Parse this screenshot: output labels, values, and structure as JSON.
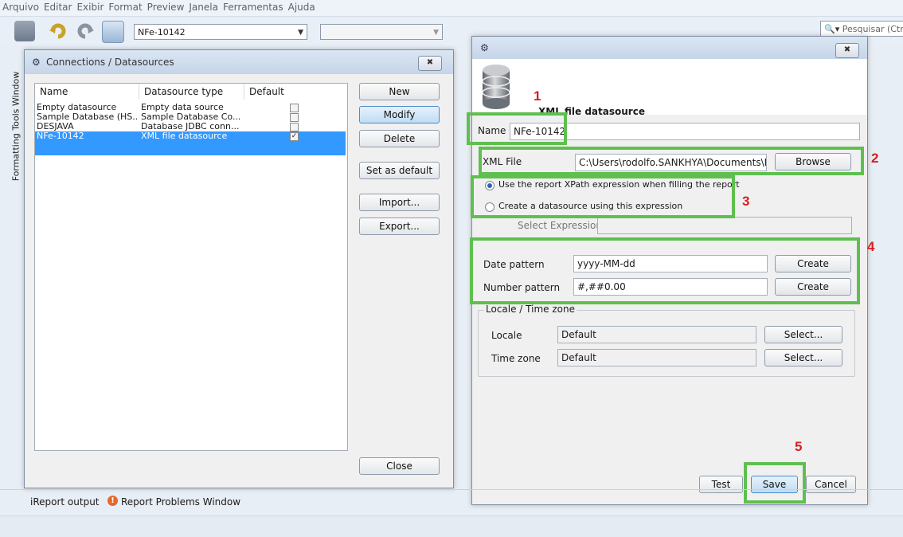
{
  "menu": [
    "Arquivo",
    "Editar",
    "Exibir",
    "Format",
    "Preview",
    "Janela",
    "Ferramentas",
    "Ajuda"
  ],
  "toolbar": {
    "datasource_combo": "NFe-10142",
    "search_placeholder": "Pesquisar (Ctr"
  },
  "side_tab": "Formatting Tools Window",
  "connections": {
    "title": "Connections / Datasources",
    "close_x": "✖",
    "columns": [
      "Name",
      "Datasource type",
      "Default"
    ],
    "rows": [
      {
        "name": "Empty datasource",
        "type": "Empty data source",
        "default": ""
      },
      {
        "name": "Sample Database (HS...",
        "type": "Sample Database Co...",
        "default": ""
      },
      {
        "name": "DESJAVA",
        "type": "Database JDBC conn...",
        "default": ""
      },
      {
        "name": "NFe-10142",
        "type": "XML file datasource",
        "default": "✓"
      }
    ],
    "buttons": {
      "new": "New",
      "modify": "Modify",
      "delete": "Delete",
      "set_default": "Set as default",
      "import": "Import...",
      "export": "Export...",
      "close": "Close"
    }
  },
  "xml_dialog": {
    "close_x": "✖",
    "heading": "XML file datasource",
    "name_label": "Name",
    "name_value": "NFe-10142",
    "xml_file_label": "XML File",
    "xml_file_value": "C:\\Users\\rodolfo.SANKHYA\\Documents\\NFe\\",
    "browse": "Browse",
    "radio_report": "Use the report XPath expression when filling the report",
    "radio_create": "Create a datasource using this expression",
    "select_expression": "Select Expression",
    "date_pattern_label": "Date pattern",
    "date_pattern_value": "yyyy-MM-dd",
    "number_pattern_label": "Number pattern",
    "number_pattern_value": "#,##0.00",
    "create": "Create",
    "locale_group": "Locale / Time zone",
    "locale_label": "Locale",
    "locale_value": "Default",
    "timezone_label": "Time zone",
    "timezone_value": "Default",
    "select": "Select...",
    "test": "Test",
    "save": "Save",
    "cancel": "Cancel"
  },
  "annotations": [
    "1",
    "2",
    "3",
    "4",
    "5"
  ],
  "status_bar": {
    "ireport_output": "iReport output",
    "problems": "Report Problems Window"
  },
  "colors": {
    "highlight_box": "#5fbf4f",
    "annotation_number": "#d81e1e",
    "selection": "#3399ff"
  }
}
